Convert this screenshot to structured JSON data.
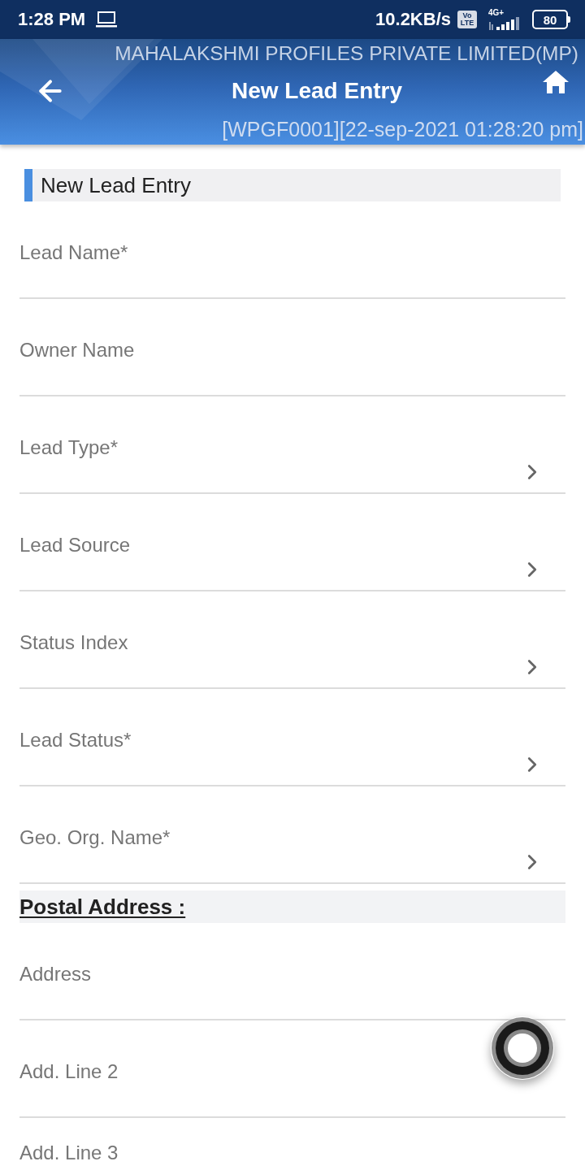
{
  "status_bar": {
    "time": "1:28 PM",
    "network_speed": "10.2KB/s",
    "volte_badge": {
      "top": "Vo",
      "bottom": "LTE"
    },
    "network_type": "4G+",
    "battery": "80"
  },
  "header": {
    "company": "MAHALAKSHMI PROFILES PRIVATE LIMITED(MP)",
    "title": "New Lead Entry",
    "session": "[WPGF0001][22-sep-2021 01:28:20 pm]"
  },
  "section": {
    "title": "New Lead Entry"
  },
  "fields": [
    {
      "kind": "text",
      "label": "Lead Name*"
    },
    {
      "kind": "text",
      "label": "Owner Name"
    },
    {
      "kind": "select",
      "label": "Lead Type*"
    },
    {
      "kind": "select",
      "label": "Lead Source"
    },
    {
      "kind": "select",
      "label": "Status Index"
    },
    {
      "kind": "select",
      "label": "Lead Status*"
    },
    {
      "kind": "select",
      "label": "Geo. Org. Name*"
    }
  ],
  "postal_section": {
    "title": "Postal Address :"
  },
  "address_fields": [
    {
      "kind": "text",
      "label": "Address"
    },
    {
      "kind": "text",
      "label": "Add. Line 2"
    },
    {
      "kind": "text",
      "label": "Add. Line 3"
    }
  ]
}
